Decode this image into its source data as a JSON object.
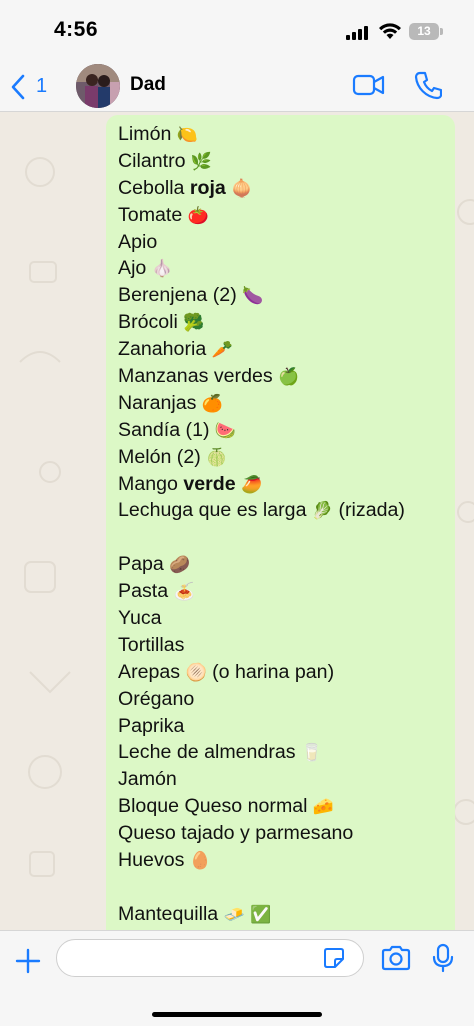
{
  "status_bar": {
    "time": "4:56",
    "battery": "13"
  },
  "header": {
    "back_count": "1",
    "contact_name": "Dad",
    "accent_color": "#1a7bff"
  },
  "message": {
    "lines": [
      {
        "text": "Limón",
        "bold": "",
        "after": "",
        "emoji": "🍋"
      },
      {
        "text": "Cilantro",
        "bold": "",
        "after": "",
        "emoji": "🌿"
      },
      {
        "text": "Cebolla ",
        "bold": "roja",
        "after": "",
        "emoji": "🧅"
      },
      {
        "text": "Tomate",
        "bold": "",
        "after": "",
        "emoji": "🍅"
      },
      {
        "text": "Apio",
        "bold": "",
        "after": "",
        "emoji": ""
      },
      {
        "text": "Ajo",
        "bold": "",
        "after": "",
        "emoji": "🧄"
      },
      {
        "text": "Berenjena (2)",
        "bold": "",
        "after": "",
        "emoji": "🍆"
      },
      {
        "text": "Brócoli",
        "bold": "",
        "after": "",
        "emoji": "🥦"
      },
      {
        "text": "Zanahoria",
        "bold": "",
        "after": "",
        "emoji": "🥕"
      },
      {
        "text": "Manzanas verdes",
        "bold": "",
        "after": "",
        "emoji": "🍏"
      },
      {
        "text": "Naranjas",
        "bold": "",
        "after": "",
        "emoji": "🍊"
      },
      {
        "text": "Sandía (1)",
        "bold": "",
        "after": "",
        "emoji": "🍉"
      },
      {
        "text": "Melón (2)",
        "bold": "",
        "after": "",
        "emoji": "🍈"
      },
      {
        "text": "Mango ",
        "bold": "verde",
        "after": "",
        "emoji": "🥭"
      },
      {
        "text": "Lechuga que es larga",
        "bold": "",
        "after": "(rizada)",
        "emoji": "🥬"
      },
      {
        "text": "",
        "bold": "",
        "after": "",
        "emoji": ""
      },
      {
        "text": "Papa",
        "bold": "",
        "after": "",
        "emoji": "🥔"
      },
      {
        "text": "Pasta",
        "bold": "",
        "after": "",
        "emoji": "🍝"
      },
      {
        "text": "Yuca",
        "bold": "",
        "after": "",
        "emoji": ""
      },
      {
        "text": "Tortillas",
        "bold": "",
        "after": "",
        "emoji": ""
      },
      {
        "text": "Arepas",
        "bold": "",
        "after": "(o harina pan)",
        "emoji": "🫓"
      },
      {
        "text": "Orégano",
        "bold": "",
        "after": "",
        "emoji": ""
      },
      {
        "text": "Paprika",
        "bold": "",
        "after": "",
        "emoji": ""
      },
      {
        "text": "Leche de almendras",
        "bold": "",
        "after": "",
        "emoji": "🥛"
      },
      {
        "text": "Jamón",
        "bold": "",
        "after": "",
        "emoji": ""
      },
      {
        "text": "Bloque Queso normal",
        "bold": "",
        "after": "",
        "emoji": "🧀"
      },
      {
        "text": "Queso tajado y parmesano",
        "bold": "",
        "after": "",
        "emoji": ""
      },
      {
        "text": "Huevos",
        "bold": "",
        "after": "",
        "emoji": "🥚"
      },
      {
        "text": "",
        "bold": "",
        "after": "",
        "emoji": ""
      },
      {
        "text": "Mantequilla",
        "bold": "",
        "after": "",
        "emoji": "🧈 ✅"
      }
    ],
    "bubble_color": "#dcf8c6"
  },
  "composer": {
    "input_value": "",
    "input_placeholder": ""
  }
}
